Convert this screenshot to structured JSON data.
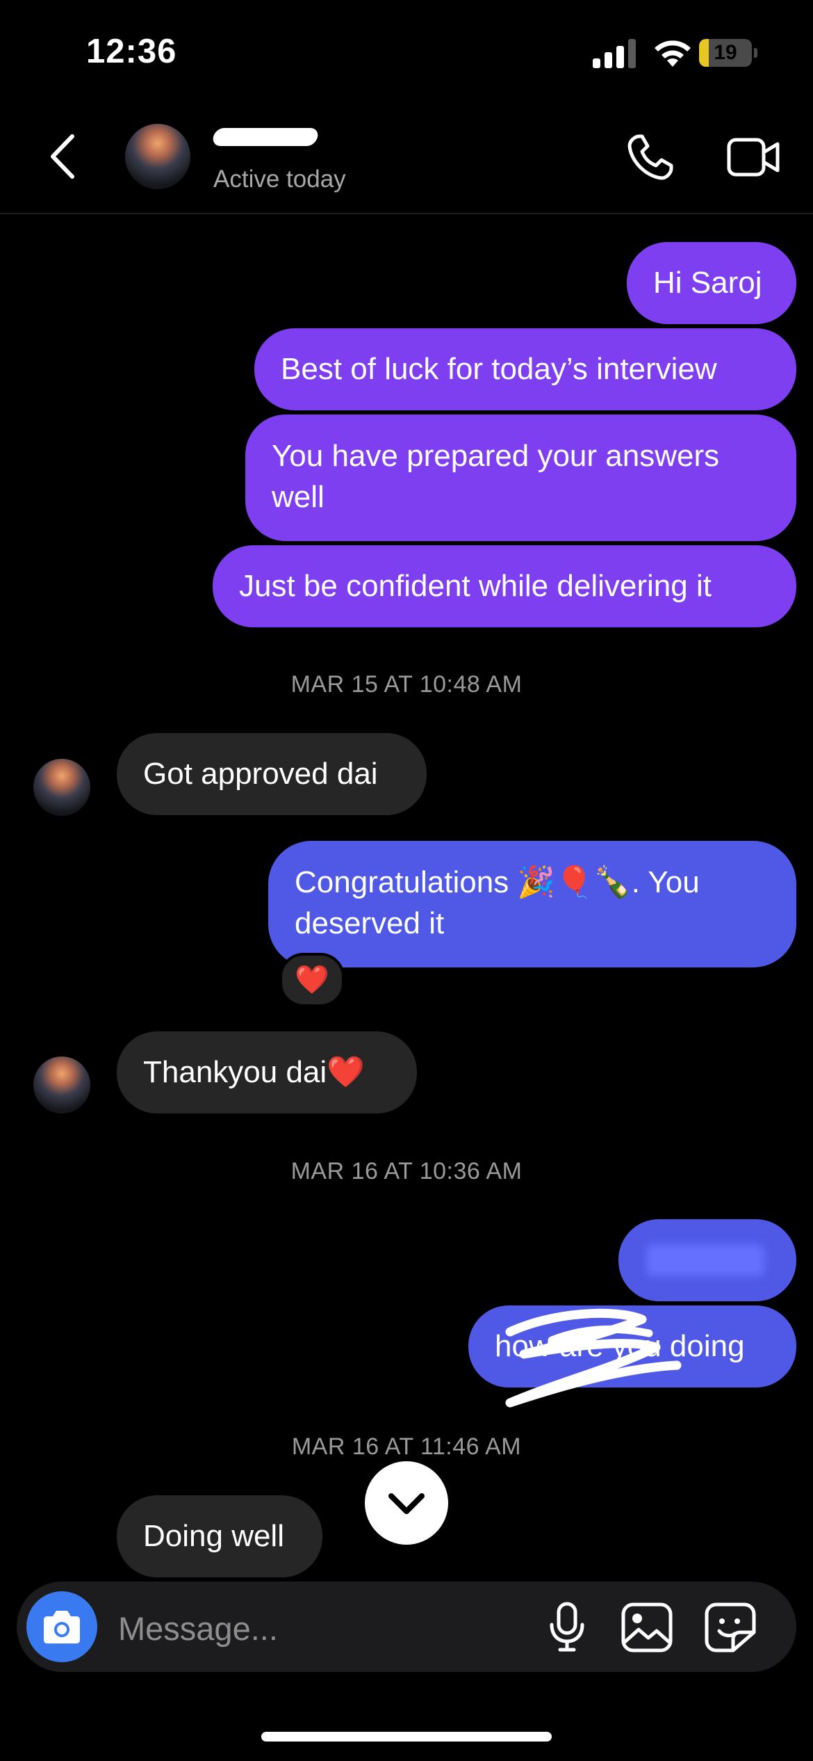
{
  "status_bar": {
    "time": "12:36",
    "battery_level": "19",
    "battery_fraction": 0.19
  },
  "header": {
    "active_status": "Active today"
  },
  "messages": {
    "m1": "Hi Saroj",
    "m2": "Best of luck for today’s interview",
    "m3": "You have prepared your answers well",
    "m4": "Just be confident while delivering it",
    "stamp1": "MAR 15 AT 10:48 AM",
    "m5": "Got approved dai",
    "m6": "Congratulations 🎉🎈🍾. You deserved it",
    "m6_reaction": "❤️",
    "m7": "Thankyou dai❤️",
    "stamp2": "MAR 16 AT 10:36 AM",
    "m9": "how are you doing",
    "stamp3": "MAR 16 AT 11:46 AM",
    "m10": "Doing well"
  },
  "composer": {
    "placeholder": "Message..."
  },
  "icons": {
    "status": [
      "cellular-signal-icon",
      "wifi-icon",
      "battery-icon"
    ],
    "header": [
      "back-chevron-icon",
      "phone-icon",
      "video-camera-icon"
    ],
    "composer": [
      "camera-icon",
      "microphone-icon",
      "image-gallery-icon",
      "sticker-icon"
    ],
    "chat": [
      "chevron-down-icon"
    ]
  },
  "colors": {
    "background": "#000000",
    "outgoing_purple": "#7e3ff0",
    "outgoing_blue": "#4f59e6",
    "incoming": "#262626",
    "camera_button": "#3a7af0",
    "timestamp": "#9a9a9a"
  }
}
